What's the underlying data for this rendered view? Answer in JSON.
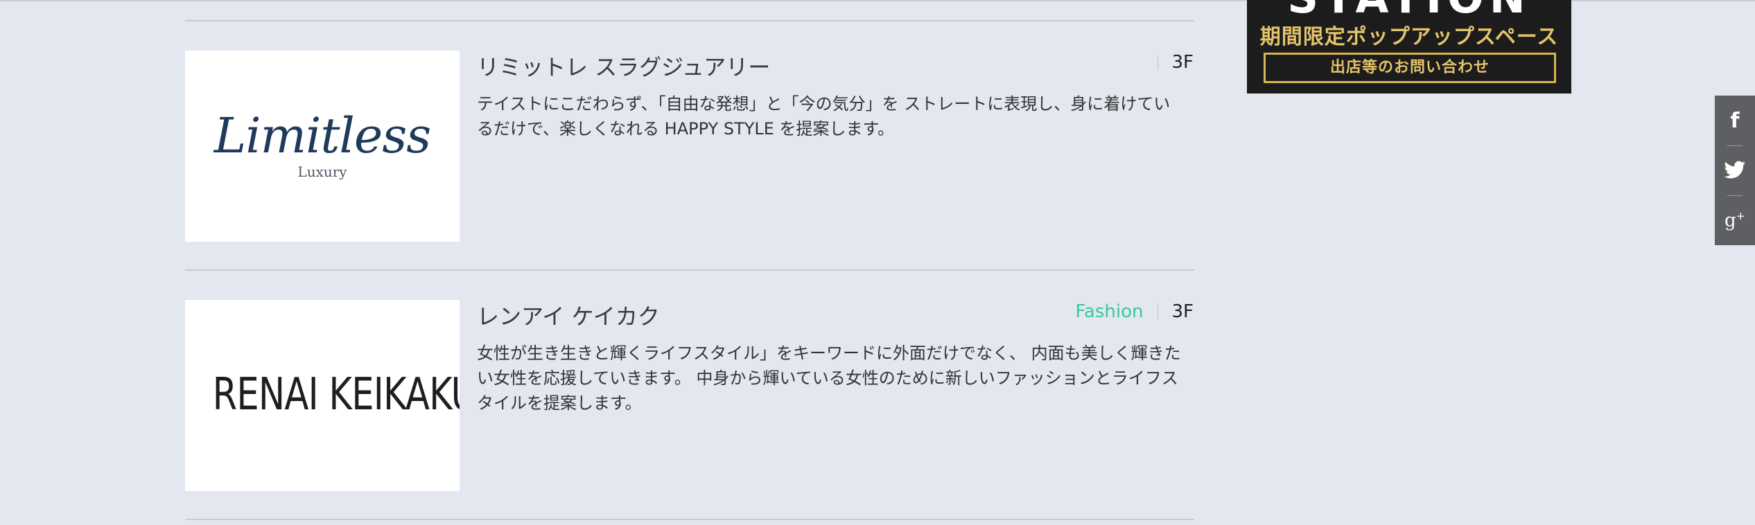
{
  "shops": [
    {
      "name": "リミットレ スラグジュアリー",
      "category": "",
      "floor": "3F",
      "description": "テイストにこだわらず、「自由な発想」と「今の気分」を ストレートに表現し、身に着けているだけで、楽しくなれる HAPPY STYLE を提案します。",
      "logo_text": "Limitless",
      "logo_subtext": "Luxury"
    },
    {
      "name": "レンアイ ケイカク",
      "category": "Fashion",
      "floor": "3F",
      "description": "女性が生き生きと輝くライフスタイル」をキーワードに外面だけでなく、 内面も美しく輝きたい女性を応援していきます。 中身から輝いている女性のために新しいファッションとライフスタイルを提案します。",
      "logo_text": "RENAI KEIKAKU"
    }
  ],
  "banner": {
    "big_text": "STATION",
    "title": "期間限定ポップアップスペース",
    "button_label": "出店等のお問い合わせ"
  },
  "social": {
    "facebook_glyph": "f",
    "googleplus_glyph": "g"
  },
  "colors": {
    "background": "#e2e7f0",
    "category_accent": "#3cc79a",
    "banner_gold": "#e4c36a",
    "social_bar": "#5d5f62"
  }
}
